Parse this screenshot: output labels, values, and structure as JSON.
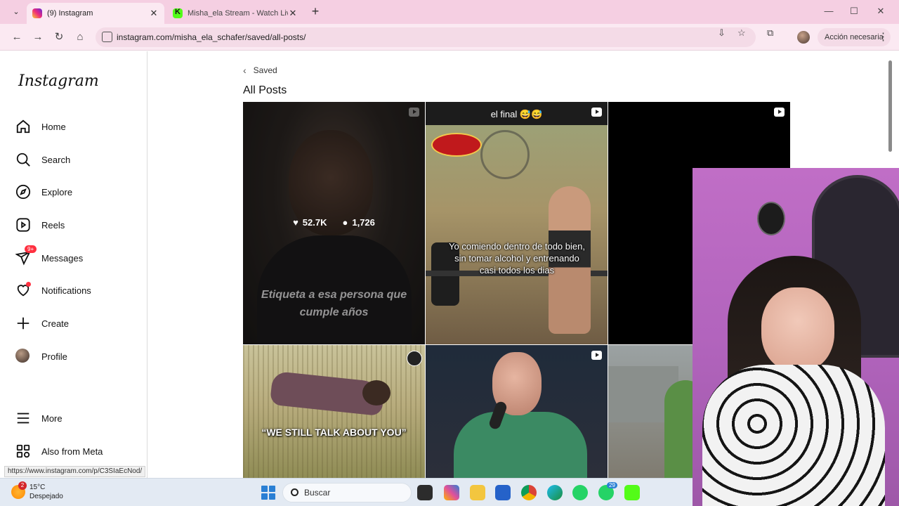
{
  "browser": {
    "tabs": [
      {
        "title": "(9) Instagram",
        "active": true
      },
      {
        "title": "Misha_ela Stream - Watch Live",
        "active": false
      }
    ],
    "url": "instagram.com/misha_ela_schafer/saved/all-posts/",
    "action_button": "Acción necesaria",
    "status_url": "https://www.instagram.com/p/C3SIaEcNod/"
  },
  "sidebar": {
    "logo": "Instagram",
    "items": [
      {
        "label": "Home",
        "icon": "home-icon"
      },
      {
        "label": "Search",
        "icon": "search-icon"
      },
      {
        "label": "Explore",
        "icon": "compass-icon"
      },
      {
        "label": "Reels",
        "icon": "reels-icon"
      },
      {
        "label": "Messages",
        "icon": "messenger-icon",
        "badge": "9+"
      },
      {
        "label": "Notifications",
        "icon": "heart-icon"
      },
      {
        "label": "Create",
        "icon": "plus-icon"
      },
      {
        "label": "Profile",
        "icon": "avatar"
      },
      {
        "label": "More",
        "icon": "menu-icon"
      },
      {
        "label": "Also from Meta",
        "icon": "meta-apps-icon"
      }
    ]
  },
  "main": {
    "back_label": "Saved",
    "title": "All Posts",
    "posts": [
      {
        "likes": "52.7K",
        "comments": "1,726",
        "caption": "Etiqueta a esa persona que cumple años"
      },
      {
        "top_text": "el final 😅😅",
        "caption": "Yo comiendo dentro de todo bien, sin tomar alcohol y entrenando casi todos los dias"
      },
      {
        "caption": ""
      },
      {
        "caption": "“WE STILL TALK ABOUT YOU”"
      },
      {
        "caption": ""
      },
      {
        "caption": ""
      }
    ]
  },
  "taskbar": {
    "weather_temp": "15°C",
    "weather_desc": "Despejado",
    "weather_badge": "2",
    "search_placeholder": "Buscar",
    "whatsapp_badge": "29"
  },
  "colors": {
    "tabbar": "#f5cfe2",
    "toolbar": "#fbe9f2",
    "notification_red": "#ff3040"
  }
}
